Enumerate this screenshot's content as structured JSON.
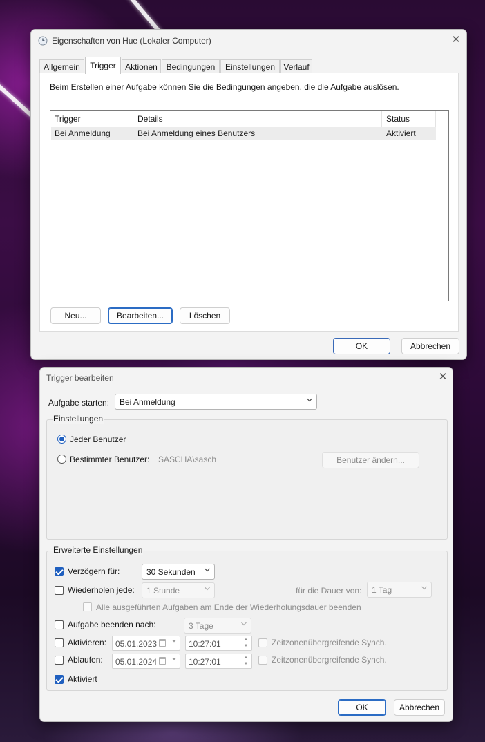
{
  "properties_dialog": {
    "title": "Eigenschaften von Hue (Lokaler Computer)",
    "tabs": [
      "Allgemein",
      "Trigger",
      "Aktionen",
      "Bedingungen",
      "Einstellungen",
      "Verlauf"
    ],
    "active_tab": "Trigger",
    "description": "Beim Erstellen einer Aufgabe können Sie die Bedingungen angeben, die die Aufgabe auslösen.",
    "columns": [
      "Trigger",
      "Details",
      "Status"
    ],
    "rows": [
      {
        "trigger": "Bei Anmeldung",
        "details": "Bei Anmeldung eines Benutzers",
        "status": "Aktiviert"
      }
    ],
    "new_button": "Neu...",
    "edit_button": "Bearbeiten...",
    "delete_button": "Löschen",
    "ok_button": "OK",
    "cancel_button": "Abbrechen"
  },
  "trigger_dialog": {
    "title": "Trigger bearbeiten",
    "start_label": "Aufgabe starten:",
    "start_value": "Bei Anmeldung",
    "settings_group": "Einstellungen",
    "any_user": "Jeder Benutzer",
    "specific_user": "Bestimmter Benutzer:",
    "user_name": "SASCHA\\sasch",
    "change_user_button": "Benutzer ändern...",
    "advanced_group": "Erweiterte Einstellungen",
    "delay_label": "Verzögern für:",
    "delay_value": "30 Sekunden",
    "delay_checked": true,
    "repeat_label": "Wiederholen jede:",
    "repeat_value": "1 Stunde",
    "repeat_checked": false,
    "duration_label": "für die Dauer von:",
    "duration_value": "1 Tag",
    "stop_all_label": "Alle ausgeführten Aufgaben am Ende der Wiederholungsdauer beenden",
    "stop_after_label": "Aufgabe beenden nach:",
    "stop_after_value": "3 Tage",
    "activate_label": "Aktivieren:",
    "activate_date": "05.01.2023",
    "activate_time": "10:27:01",
    "expire_label": "Ablaufen:",
    "expire_date": "05.01.2024",
    "expire_time": "10:27:01",
    "sync_label": "Zeitzonenübergreifende Synch.",
    "enabled_label": "Aktiviert",
    "enabled_checked": true,
    "ok_button": "OK",
    "cancel_button": "Abbrechen"
  },
  "colors": {
    "accent": "#1f5fbf",
    "wallpaper": "#3b0d45"
  }
}
